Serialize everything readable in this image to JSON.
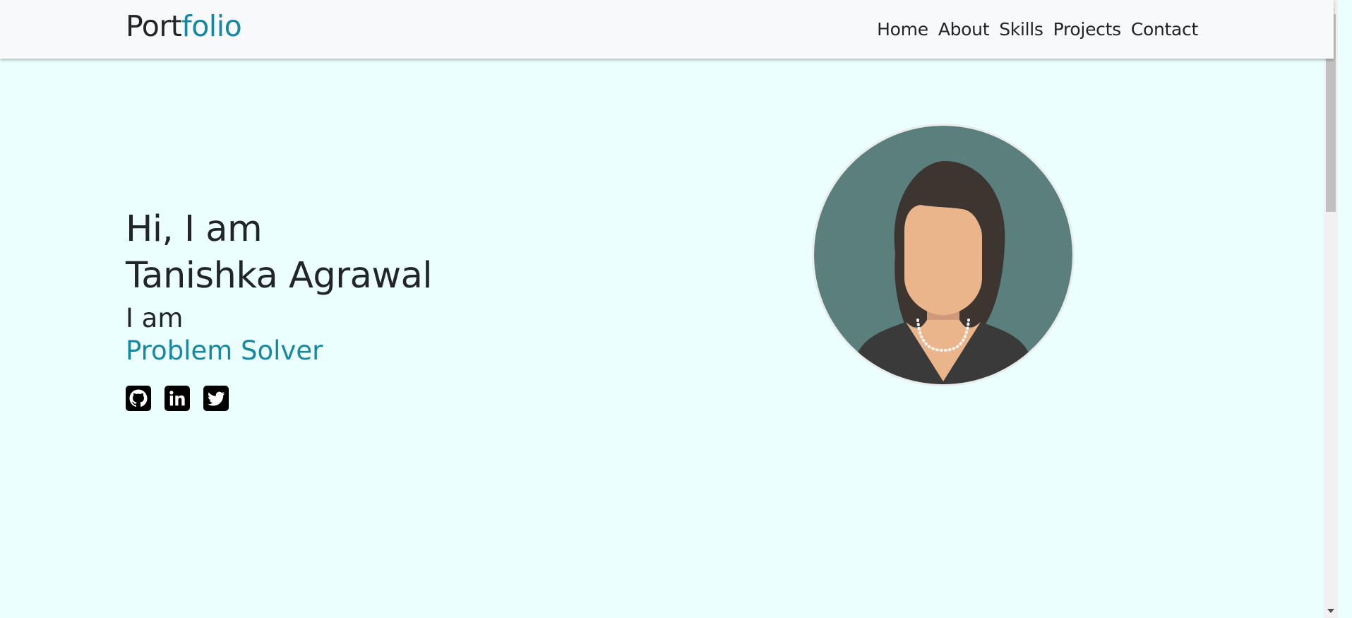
{
  "nav": {
    "brand_main": "Port",
    "brand_accent": "folio",
    "links": [
      "Home",
      "About",
      "Skills",
      "Projects",
      "Contact"
    ]
  },
  "hero": {
    "greeting": "Hi, I am",
    "name": "Tanishka Agrawal",
    "iam": "I am",
    "role": "Problem Solver"
  },
  "socials": [
    {
      "icon": "github-icon"
    },
    {
      "icon": "linkedin-icon"
    },
    {
      "icon": "twitter-icon"
    }
  ],
  "colors": {
    "accent": "#17889f",
    "background": "#eafffe",
    "navbar": "#f8f9fa",
    "text": "#212529",
    "avatar_bg": "#5a7f7c"
  }
}
